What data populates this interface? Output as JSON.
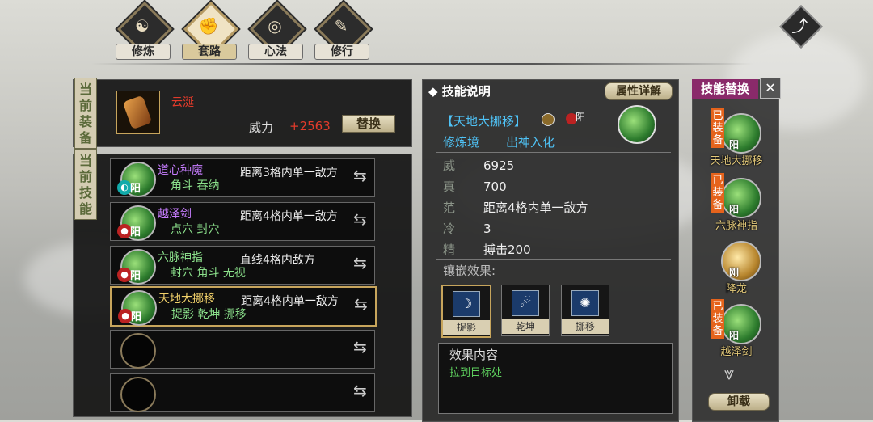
{
  "tabs": [
    {
      "label": "修炼",
      "icon": "cultivate-icon",
      "glyph": "☯"
    },
    {
      "label": "套路",
      "icon": "fist-icon",
      "glyph": "✊",
      "active": true
    },
    {
      "label": "心法",
      "icon": "swirl-icon",
      "glyph": "◎"
    },
    {
      "label": "修行",
      "icon": "scroll-icon",
      "glyph": "✎"
    }
  ],
  "back_icon": "⤴",
  "equipment": {
    "tag": "当前装备",
    "item_name": "云涎",
    "power_label": "威力",
    "power_value": "+2563",
    "replace_button": "替换"
  },
  "current_skills": {
    "tag": "当前技能",
    "slots": [
      {
        "name": "道心种魔",
        "name_color": "#c77dff",
        "sub": "角斗  吞纳",
        "range": "距离3格内单一敌方",
        "yin": "阳",
        "badge": "cyan"
      },
      {
        "name": "越泽剑",
        "name_color": "#c77dff",
        "sub": "点穴  封穴",
        "range": "距离4格内单一敌方",
        "yin": "阳",
        "badge": "red"
      },
      {
        "name": "六脉神指",
        "name_color": "#8be08b",
        "sub": "封穴  角斗  无视",
        "range": "直线4格内敌方",
        "yin": "阳",
        "badge": "red"
      },
      {
        "name": "天地大挪移",
        "name_color": "#f2d16a",
        "sub": "捉影  乾坤  挪移",
        "range": "距离4格内单一敌方",
        "yin": "阳",
        "badge": "red",
        "selected": true
      }
    ]
  },
  "detail": {
    "header": "技能说明",
    "attr_button": "属性详解",
    "skill_title": "【天地大挪移】",
    "skill_yin": "阳",
    "realm_label": "修炼境",
    "realm_value": "出神入化",
    "stats": [
      {
        "k": "威",
        "v": "6925"
      },
      {
        "k": "真",
        "v": "700"
      },
      {
        "k": "范",
        "v": "距离4格内单一敌方"
      },
      {
        "k": "冷",
        "v": "3"
      },
      {
        "k": "精",
        "v": "搏击200"
      }
    ],
    "inlay_label": "镶嵌效果:",
    "gems": [
      {
        "label": "捉影",
        "glyph": "☽"
      },
      {
        "label": "乾坤",
        "glyph": "☄"
      },
      {
        "label": "挪移",
        "glyph": "✺"
      }
    ],
    "effect_title": "效果内容",
    "effect_text": "拉到目标处"
  },
  "replace_panel": {
    "header": "技能替换",
    "close": "✕",
    "equipped_label": "已装备",
    "items": [
      {
        "name": "天地大挪移",
        "equipped": true,
        "tag": "阳"
      },
      {
        "name": "六脉神指",
        "equipped": true,
        "tag": "阳"
      },
      {
        "name": "降龙",
        "equipped": false,
        "tag": "刚",
        "gold": true
      },
      {
        "name": "越泽剑",
        "equipped": true,
        "tag": "阳"
      }
    ],
    "down_icon": "⩔",
    "unload_button": "卸载"
  }
}
